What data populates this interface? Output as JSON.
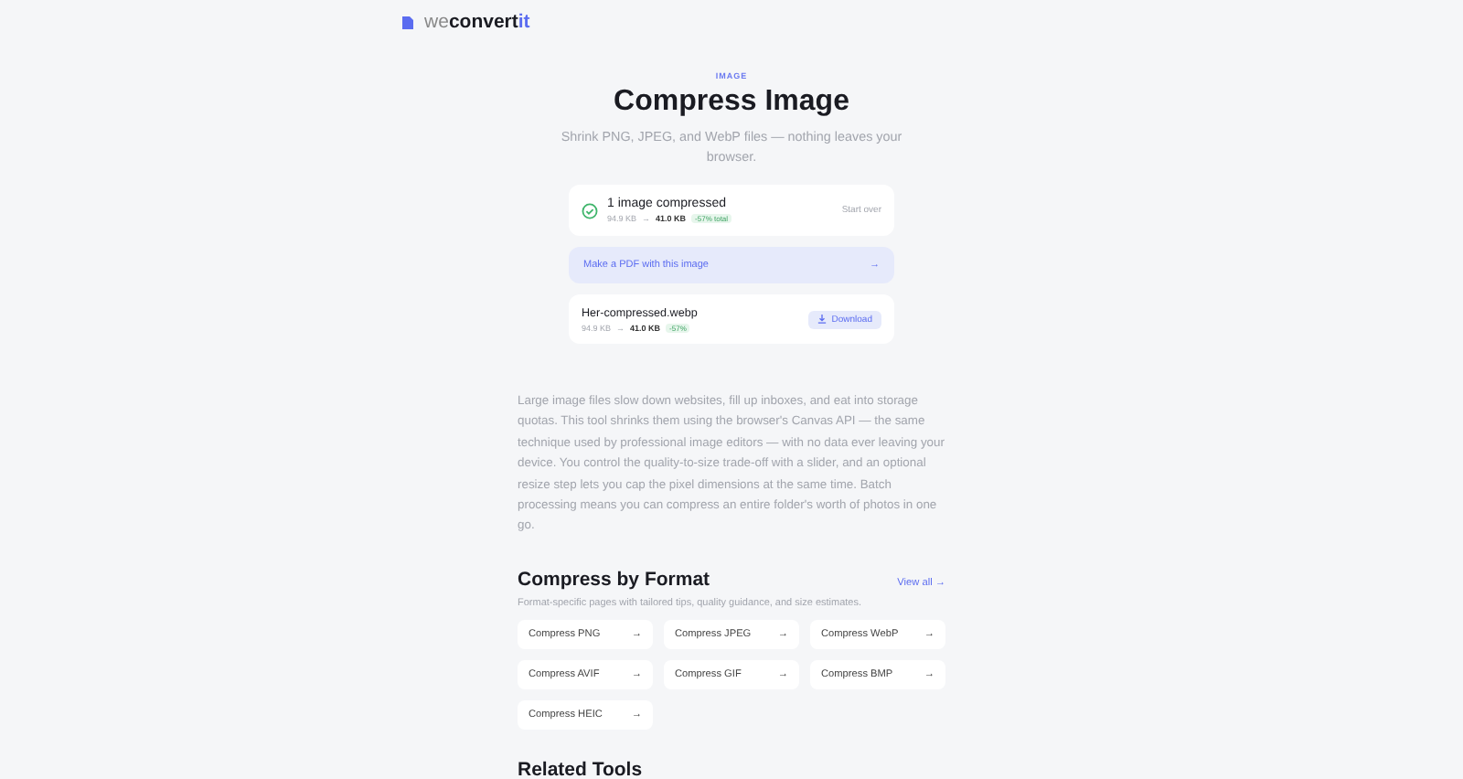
{
  "logo": {
    "prefix": "we",
    "main": "convert",
    "suffix": "it"
  },
  "hero": {
    "eyebrow": "IMAGE",
    "title": "Compress Image",
    "subtitle": "Shrink PNG, JPEG, and WebP files — nothing leaves your browser."
  },
  "summary": {
    "title": "1 image compressed",
    "original": "94.9 KB",
    "arrow": "→",
    "result": "41.0 KB",
    "badge": "-57% total",
    "action": "Start over"
  },
  "pdf_button": {
    "label": "Make a PDF with this image",
    "arrow": "→"
  },
  "files": [
    {
      "name": "Her-compressed.webp",
      "original": "94.9 KB",
      "arrow": "→",
      "result": "41.0 KB",
      "badge": "-57%",
      "action": "Download"
    }
  ],
  "description": "Large image files slow down websites, fill up inboxes, and eat into storage quotas. This tool shrinks them using the browser's Canvas API — the same technique used by professional image editors — with no data ever leaving your device. You control the quality-to-size trade-off with a slider, and an optional resize step lets you cap the pixel dimensions at the same time. Batch processing means you can compress an entire folder's worth of photos in one go.",
  "format_section": {
    "title": "Compress by Format",
    "link": "View all →",
    "subtitle": "Format-specific pages with tailored tips, quality guidance, and size estimates.",
    "items": [
      {
        "label": "Compress PNG",
        "arrow": "→"
      },
      {
        "label": "Compress JPEG",
        "arrow": "→"
      },
      {
        "label": "Compress WebP",
        "arrow": "→"
      },
      {
        "label": "Compress AVIF",
        "arrow": "→"
      },
      {
        "label": "Compress GIF",
        "arrow": "→"
      },
      {
        "label": "Compress BMP",
        "arrow": "→"
      },
      {
        "label": "Compress HEIC",
        "arrow": "→"
      }
    ]
  },
  "related_section": {
    "title": "Related Tools"
  }
}
